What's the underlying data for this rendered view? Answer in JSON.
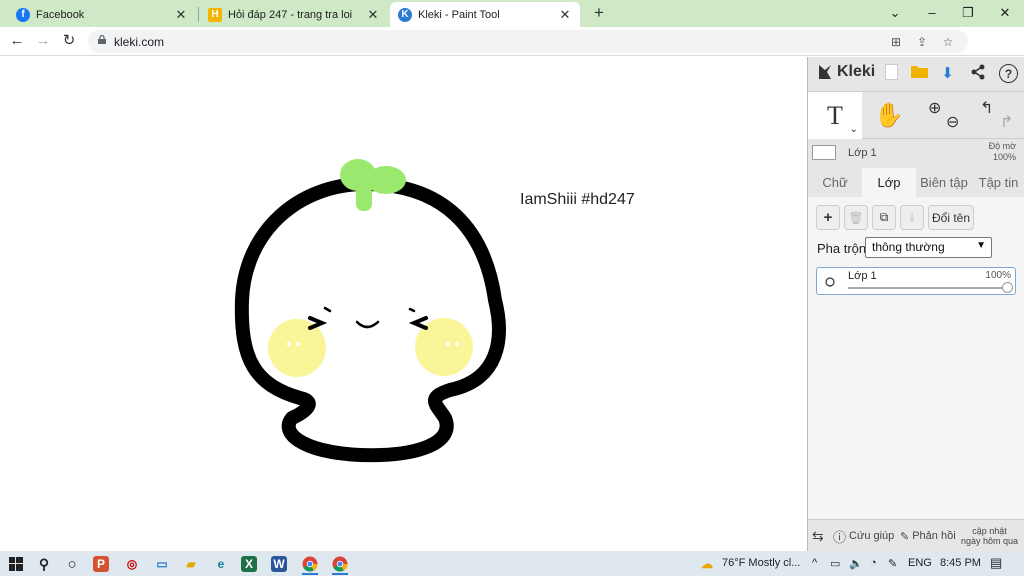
{
  "browser": {
    "tabs": [
      {
        "title": "Facebook",
        "favicon": "facebook-icon",
        "active": false
      },
      {
        "title": "Hỏi đáp 247 - trang tra loi",
        "favicon": "hoidap247-icon",
        "active": false
      },
      {
        "title": "Kleki - Paint Tool",
        "favicon": "kleki-icon",
        "active": true
      }
    ],
    "new_tab": "+",
    "url": "kleki.com",
    "tab_close": "✕"
  },
  "canvas": {
    "text": "IamShiii #hd247"
  },
  "kleki": {
    "logo": "Kleki",
    "tools": [
      "T",
      "hand-icon",
      "zoom-icon",
      "undo-redo-icon"
    ],
    "layer_preview": {
      "name": "Lớp 1",
      "opacity_label": "Độ mờ",
      "opacity": "100%"
    },
    "tabs": [
      "Chữ",
      "Lớp",
      "Biên tập",
      "Tập tin"
    ],
    "active_tab": "Lớp",
    "rename_label": "Đổi tên",
    "blend_label": "Pha trộn",
    "blend_value": "thông thường",
    "layers": [
      {
        "name": "Lớp 1",
        "opacity": "100%",
        "opacity_value": 1.0
      }
    ],
    "bottom": {
      "help": "Cứu giúp",
      "feedback": "Phản hồi",
      "update_line1": "cập nhật",
      "update_line2": "ngày hôm qua"
    },
    "colors": {
      "accent": "#2a7bd4",
      "panel": "#f5f5f5"
    }
  },
  "taskbar": {
    "weather": "76°F  Mostly cl...",
    "lang": "ENG",
    "time": "8:45 PM"
  }
}
